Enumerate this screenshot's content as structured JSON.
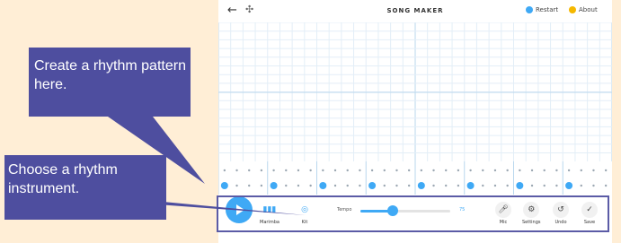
{
  "colors": {
    "background": "#FFEED6",
    "accent": "#3FA9F5",
    "callout": "#4E4E9F",
    "frame": "#5B5BA6",
    "restart_icon": "#3FA9F5",
    "about_icon": "#F5B800"
  },
  "header": {
    "title": "SONG MAKER",
    "restart_label": "Restart",
    "about_label": "About",
    "back_icon": "arrow-left-icon",
    "move_icon": "move-icon"
  },
  "callouts": [
    {
      "text": "Create a rhythm pattern here."
    },
    {
      "text": "Choose a rhythm instrument."
    }
  ],
  "controls": {
    "play_icon": "play-icon",
    "instrument_label": "Marimba",
    "rhythm_label": "Kit",
    "tempo_label": "Tempo",
    "tempo_value": "75",
    "tempo_level": 0.36,
    "mic_label": "Mic",
    "settings_label": "Settings",
    "undo_label": "Undo",
    "save_label": "Save"
  },
  "rhythm_grid": {
    "columns": 32,
    "active_top": [],
    "active_bottom": [
      0,
      4,
      8,
      12,
      16,
      20,
      24,
      28
    ]
  }
}
